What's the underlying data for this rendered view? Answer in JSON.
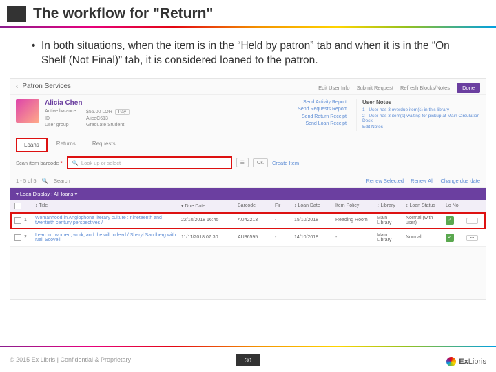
{
  "slide": {
    "title": "The workflow for \"Return\"",
    "bullet": "In both situations, when the item is in the “Held by patron” tab and when it is in the “On Shelf (Not Final)” tab, it is considered loaned to the patron.",
    "page": "30",
    "copyright": "© 2015 Ex Libris | Confidential & Proprietary",
    "logo": "ExLibris"
  },
  "shot": {
    "breadcrumb": "Patron Services",
    "topActions": {
      "edit": "Edit User Info",
      "submit": "Submit Request",
      "refresh": "Refresh Blocks/Notes",
      "done": "Done"
    },
    "user": {
      "name": "Alicia Chen",
      "fields": {
        "balLabel": "Active balance",
        "bal": "$55.00 LOR",
        "pay": "Pay",
        "idLabel": "ID",
        "id": "AliceC613",
        "groupLabel": "User group",
        "group": "Graduate Student"
      }
    },
    "links": {
      "a": "Send Activity Report",
      "b": "Send Requests Report",
      "c": "Send Return Receipt",
      "d": "Send Loan Receipt"
    },
    "notes": {
      "head": "User Notes",
      "n1": "1 - User has 3 overdue item(s) in this library",
      "n2": "2 - User has 3 item(s) waiting for pickup at Main Circulation Desk",
      "edit": "Edit Notes"
    },
    "tabs": {
      "loans": "Loans",
      "returns": "Returns",
      "requests": "Requests"
    },
    "scan": {
      "label": "Scan item barcode",
      "star": "*",
      "placeholder": "Look up or select",
      "list": "☰",
      "ok": "OK",
      "create": "Create Item"
    },
    "row2": {
      "count": "1 - 5 of 5",
      "search": "Search",
      "renewSel": "Renew Selected",
      "renewAll": "Renew All",
      "change": "Change due date"
    },
    "filter": "Loan Display : All loans ▾",
    "cols": {
      "title": "Title",
      "due": "Due Date",
      "bar": "Barcode",
      "fine": "Fir",
      "ldate": "Loan Date",
      "pol": "Item Policy",
      "lib": "Library",
      "stat": "Loan Status",
      "lono": "Lo No"
    },
    "rows": [
      {
        "idx": "1",
        "title": "Womanhood in Anglophone literary culture : nineteenth and twentieth century perspectives /",
        "due": "22/10/2018 16:45",
        "bar": "AU42213",
        "fine": "-",
        "ldate": "15/10/2018",
        "pol": "Reading Room",
        "lib": "Main Library",
        "stat": "Normal (with user)"
      },
      {
        "idx": "2",
        "title": "Lean in : women, work, and the will to lead / Sheryl Sandberg with Nell Scovell.",
        "due": "11/11/2018 07:30",
        "bar": "AU36595",
        "fine": "-",
        "ldate": "14/10/2018",
        "pol": "-",
        "lib": "Main Library",
        "stat": "Normal"
      }
    ]
  }
}
